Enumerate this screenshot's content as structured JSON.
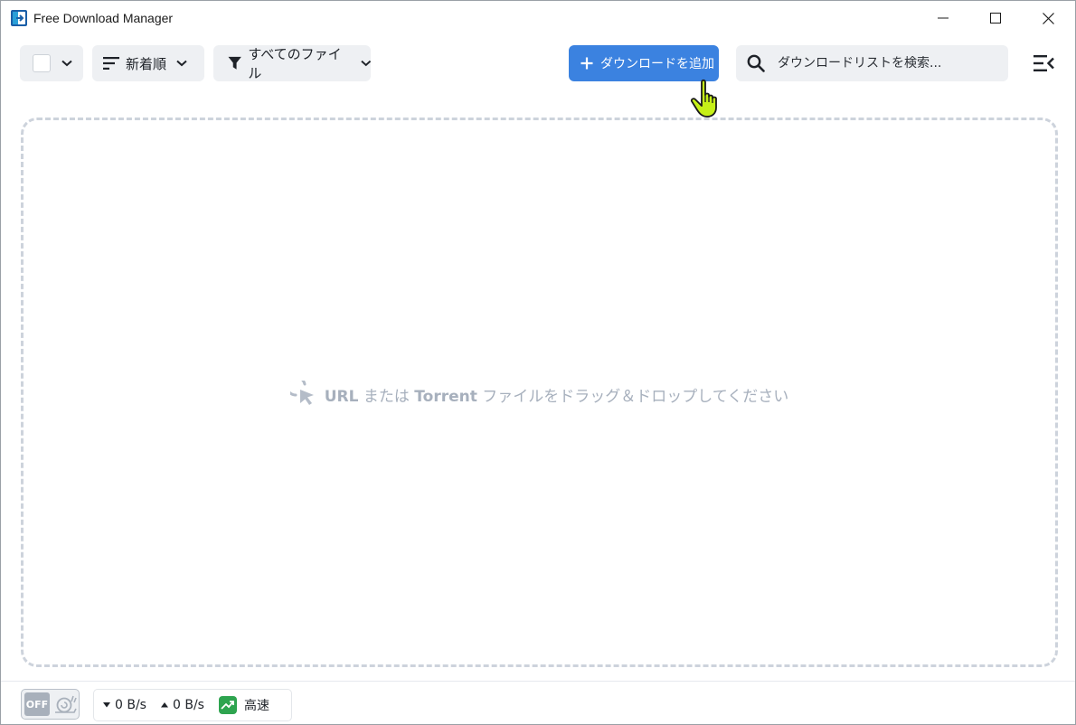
{
  "window": {
    "title": "Free Download Manager"
  },
  "toolbar": {
    "sort_label": "新着順",
    "filter_label": "すべてのファイル",
    "add_download_label": "ダウンロードを追加",
    "search_placeholder": "ダウンロードリストを検索..."
  },
  "dropzone": {
    "msg_url": "URL",
    "msg_mid": " または ",
    "msg_torrent": "Torrent",
    "msg_tail": " ファイルをドラッグ＆ドロップしてください"
  },
  "statusbar": {
    "snail_mode": "OFF",
    "download_speed": "0 B/s",
    "upload_speed": "0 B/s",
    "speed_mode": "高速"
  },
  "colors": {
    "accent": "#3b82e0",
    "speed_mode": "#2ea44f",
    "dropzone_border": "#cdd3dc"
  },
  "icons": [
    "app-logo",
    "minimize-icon",
    "maximize-icon",
    "close-icon",
    "chevron-down-icon",
    "sort-icon",
    "filter-icon",
    "plus-icon",
    "search-icon",
    "menu-collapse-icon",
    "drag-cursor-icon",
    "snail-icon",
    "arrow-down-icon",
    "arrow-up-icon",
    "trending-up-icon",
    "hand-cursor-icon"
  ]
}
